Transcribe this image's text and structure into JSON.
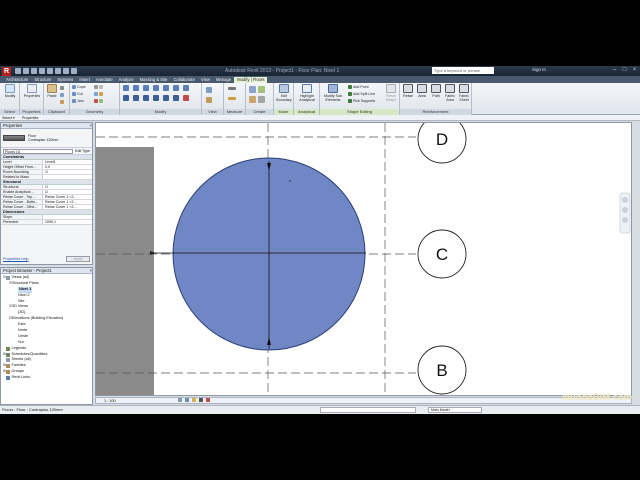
{
  "app": {
    "logo": "R",
    "title": "Autodesk Revit 2013 - Project1 - Floor Plan: Nivel 1",
    "search_placeholder": "Type a keyword or phrase",
    "sign_in": "Sign In"
  },
  "tabs": [
    {
      "label": "Architecture"
    },
    {
      "label": "Structure"
    },
    {
      "label": "Systems"
    },
    {
      "label": "Insert"
    },
    {
      "label": "Annotate"
    },
    {
      "label": "Analyze"
    },
    {
      "label": "Massing & Site"
    },
    {
      "label": "Collaborate"
    },
    {
      "label": "View"
    },
    {
      "label": "Manage"
    },
    {
      "label": "Modify | Floors"
    }
  ],
  "ribbon": {
    "panels": {
      "select": "Select",
      "properties": "Properties",
      "clipboard": "Clipboard",
      "geometry": "Geometry",
      "modify": "Modify",
      "view": "View",
      "measure": "Measure",
      "create": "Create",
      "mode": "Mode",
      "analytical": "Analytical",
      "shape_editing": "Shape Editing",
      "reinforcement": "Reinforcement"
    },
    "buttons": {
      "modify": "Modify",
      "properties": "Properties",
      "paste": "Paste",
      "cope": "Cope",
      "cut": "Cut",
      "join": "Join",
      "edit_boundary": "Edit Boundary",
      "highlight_analytical": "Highlight Analytical",
      "modify_sub_elements": "Modify Sub Elements",
      "add_point": "Add Point",
      "add_split_line": "Add Split Line",
      "pick_supports": "Pick Supports",
      "reset_shape": "Reset Shape",
      "rebar": "Rebar",
      "area": "Area",
      "path": "Path",
      "fabric_area": "Fabric Area",
      "fabric_sheet": "Fabric Sheet"
    }
  },
  "optbar": {
    "select": "Select ▾",
    "properties": "Properties"
  },
  "properties": {
    "title": "Properties",
    "type_family": "Floor",
    "type_name": "Contrapiso 120mm",
    "instance_dropdown": "Floors (1)",
    "edit_type": "Edit Type",
    "categories": {
      "constraints": "Constraints",
      "structural": "Structural",
      "dimensions": "Dimensions"
    },
    "rows_constraints": [
      {
        "k": "Level",
        "v": "Level1"
      },
      {
        "k": "Height Offset From...",
        "v": "0,0"
      },
      {
        "k": "Room Bounding",
        "v": "☑"
      },
      {
        "k": "Related to Mass",
        "v": ""
      }
    ],
    "rows_structural": [
      {
        "k": "Structural",
        "v": "☑"
      },
      {
        "k": "Enable Analytical ...",
        "v": "☑"
      },
      {
        "k": "Rebar Cover - Top ...",
        "v": "Rebar Cover 1 <2..."
      },
      {
        "k": "Rebar Cover - Botto...",
        "v": "Rebar Cover 1 <2..."
      },
      {
        "k": "Rebar Cover - Othe...",
        "v": "Rebar Cover 1 <2..."
      }
    ],
    "rows_dimensions": [
      {
        "k": "Slope",
        "v": ""
      },
      {
        "k": "Perimeter",
        "v": "1099,1"
      }
    ],
    "help": "Properties help",
    "apply": "Apply"
  },
  "browser": {
    "title": "Project Browser - Project1",
    "nodes": [
      {
        "level": 0,
        "toggle": "⊟",
        "label": "Views (all)",
        "icon": "#8a9bb0"
      },
      {
        "level": 1,
        "toggle": "⊟",
        "label": "Structural Plans",
        "icon": ""
      },
      {
        "level": 2,
        "toggle": "",
        "label": "Nivel 1",
        "icon": "",
        "selected": true
      },
      {
        "level": 2,
        "toggle": "",
        "label": "Nivel 2",
        "icon": ""
      },
      {
        "level": 2,
        "toggle": "",
        "label": "Site",
        "icon": ""
      },
      {
        "level": 1,
        "toggle": "⊟",
        "label": "3D Views",
        "icon": ""
      },
      {
        "level": 2,
        "toggle": "",
        "label": "{3D}",
        "icon": ""
      },
      {
        "level": 1,
        "toggle": "⊟",
        "label": "Elevations (Building Elevation)",
        "icon": ""
      },
      {
        "level": 2,
        "toggle": "",
        "label": "Este",
        "icon": ""
      },
      {
        "level": 2,
        "toggle": "",
        "label": "Norte",
        "icon": ""
      },
      {
        "level": 2,
        "toggle": "",
        "label": "Oeste",
        "icon": ""
      },
      {
        "level": 2,
        "toggle": "",
        "label": "Sur",
        "icon": ""
      },
      {
        "level": 0,
        "toggle": "",
        "label": "Legends",
        "icon": "#6c8b5a"
      },
      {
        "level": 0,
        "toggle": "⊞",
        "label": "Schedules/Quantities",
        "icon": "#6c8b5a"
      },
      {
        "level": 0,
        "toggle": "",
        "label": "Sheets (all)",
        "icon": "#8a9bb0"
      },
      {
        "level": 0,
        "toggle": "⊞",
        "label": "Families",
        "icon": "#b08a5a"
      },
      {
        "level": 0,
        "toggle": "⊞",
        "label": "Groups",
        "icon": "#b08a5a"
      },
      {
        "level": 0,
        "toggle": "",
        "label": "Revit Links",
        "icon": "#5a7ab0"
      }
    ]
  },
  "canvas": {
    "grid_labels": [
      "D",
      "C",
      "B"
    ],
    "floor_color": "#6f87c4"
  },
  "view_status": {
    "scale": "1 : 100"
  },
  "status": {
    "text": "Floors : Floor : Contrapiso 120mm",
    "model": "Main Model"
  },
  "watermark": "mundoBIM.com"
}
